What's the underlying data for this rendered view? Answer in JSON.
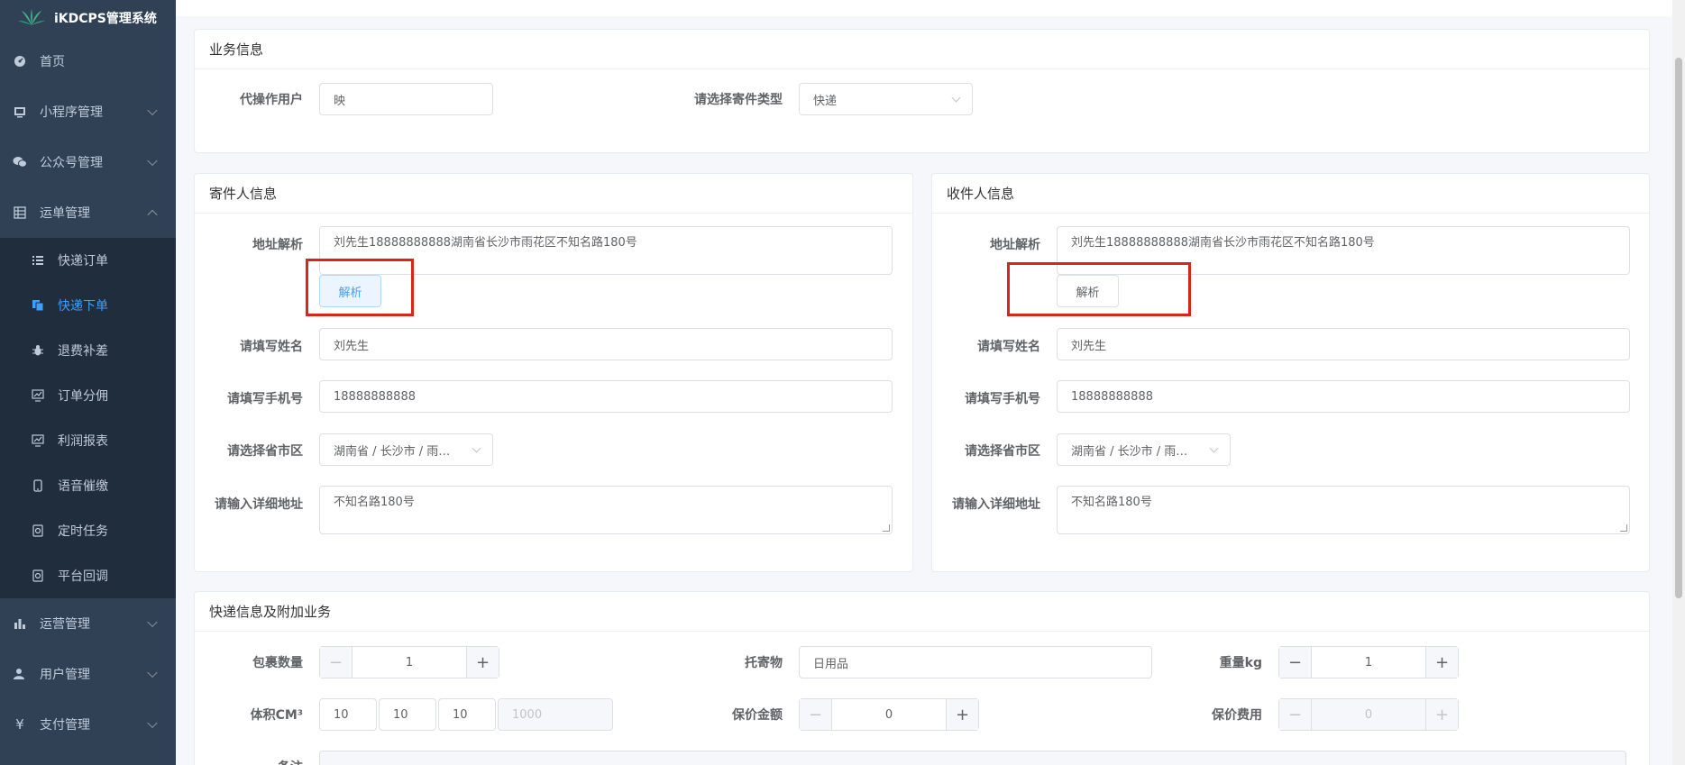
{
  "app": {
    "title": "iKDCPS管理系统"
  },
  "sidebar": {
    "items": [
      {
        "label": "首页",
        "icon": "dashboard-icon"
      },
      {
        "label": "小程序管理",
        "icon": "miniprogram-icon"
      },
      {
        "label": "公众号管理",
        "icon": "wechat-icon"
      },
      {
        "label": "运单管理",
        "icon": "grid-icon"
      }
    ],
    "subitems": [
      {
        "label": "快递订单",
        "icon": "list-icon"
      },
      {
        "label": "快递下单",
        "icon": "copy-icon"
      },
      {
        "label": "退费补差",
        "icon": "bug-icon"
      },
      {
        "label": "订单分佣",
        "icon": "chart-icon"
      },
      {
        "label": "利润报表",
        "icon": "chart-icon"
      },
      {
        "label": "语音催缴",
        "icon": "phone-icon"
      },
      {
        "label": "定时任务",
        "icon": "timer-icon"
      },
      {
        "label": "平台回调",
        "icon": "callback-icon"
      }
    ],
    "bottom": [
      {
        "label": "运营管理",
        "icon": "bar-chart-icon"
      },
      {
        "label": "用户管理",
        "icon": "user-icon"
      },
      {
        "label": "支付管理",
        "icon": "yen-icon"
      }
    ]
  },
  "business": {
    "title": "业务信息",
    "operator_label": "代操作用户",
    "operator_value": "映",
    "type_label": "请选择寄件类型",
    "type_value": "快递"
  },
  "sender": {
    "title": "寄件人信息",
    "parse_label": "地址解析",
    "parse_value": "刘先生18888888888湖南省长沙市雨花区不知名路180号",
    "parse_button": "解析",
    "name_label": "请填写姓名",
    "name_value": "刘先生",
    "phone_label": "请填写手机号",
    "phone_value": "18888888888",
    "region_label": "请选择省市区",
    "region_value": "湖南省 / 长沙市 / 雨…",
    "detail_label": "请输入详细地址",
    "detail_value": "不知名路180号"
  },
  "receiver": {
    "title": "收件人信息",
    "parse_label": "地址解析",
    "parse_value": "刘先生18888888888湖南省长沙市雨花区不知名路180号",
    "parse_button": "解析",
    "name_label": "请填写姓名",
    "name_value": "刘先生",
    "phone_label": "请填写手机号",
    "phone_value": "18888888888",
    "region_label": "请选择省市区",
    "region_value": "湖南省 / 长沙市 / 雨…",
    "detail_label": "请输入详细地址",
    "detail_value": "不知名路180号"
  },
  "express": {
    "title": "快递信息及附加业务",
    "count_label": "包裹数量",
    "count_value": "1",
    "goods_label": "托寄物",
    "goods_value": "日用品",
    "weight_label": "重量kg",
    "weight_value": "1",
    "volume_label": "体积CM³",
    "volume_l": "10",
    "volume_w": "10",
    "volume_h": "10",
    "volume_total": "1000",
    "insure_label": "保价金额",
    "insure_value": "0",
    "fee_label": "保价费用",
    "fee_value": "0",
    "remark_label": "备注"
  },
  "stepper": {
    "minus": "−",
    "plus": "+"
  },
  "colors": {
    "sidebar": "#304156",
    "submenu": "#1f2d3d",
    "accent": "#409eff",
    "highlight": "#d9251c"
  }
}
